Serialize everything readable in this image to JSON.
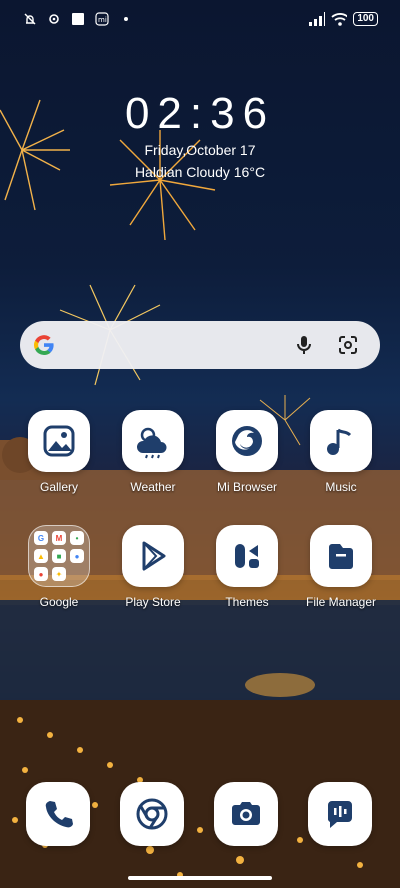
{
  "status_bar": {
    "left_icons": [
      "no-notification-icon",
      "settings-icon",
      "square-icon",
      "mi-icon",
      "dot"
    ],
    "battery": "100"
  },
  "clock": {
    "time": "02:36",
    "date": "Friday,October 17",
    "weather": "Haldian Cloudy 16°C"
  },
  "apps_row1": [
    {
      "label": "Gallery",
      "icon": "gallery-icon"
    },
    {
      "label": "Weather",
      "icon": "weather-icon"
    },
    {
      "label": "Mi Browser",
      "icon": "browser-icon"
    },
    {
      "label": "Music",
      "icon": "music-icon"
    }
  ],
  "apps_row2": [
    {
      "label": "Google",
      "icon": "google-folder"
    },
    {
      "label": "Play Store",
      "icon": "play-store-icon"
    },
    {
      "label": "Themes",
      "icon": "themes-icon"
    },
    {
      "label": "File Manager",
      "icon": "file-manager-icon"
    }
  ],
  "google_folder_items": [
    "G",
    "M",
    "•",
    "▲",
    "■",
    "●",
    "●",
    "✦",
    ""
  ],
  "dock": [
    "phone-icon",
    "chrome-icon",
    "camera-icon",
    "messages-icon"
  ],
  "colors": {
    "icon_blue": "#1f3e6b",
    "accent": "#1d3a66"
  }
}
